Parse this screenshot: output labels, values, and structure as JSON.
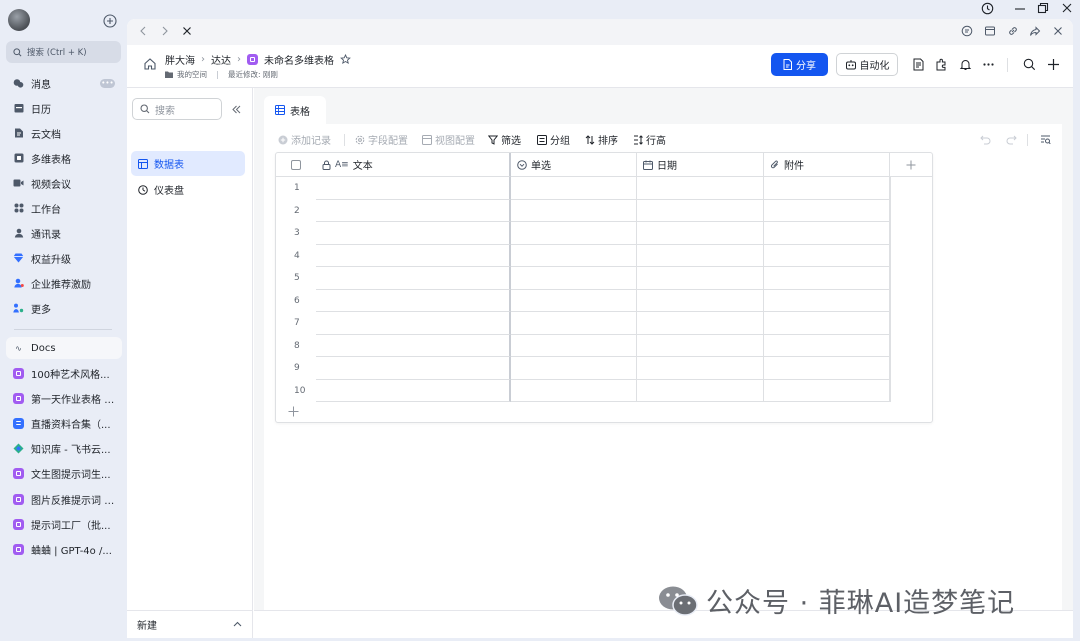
{
  "rail": {
    "search_placeholder": "搜索 (Ctrl + K)",
    "nav": [
      {
        "label": "消息",
        "icon": "chat-icon",
        "badge": "•••"
      },
      {
        "label": "日历",
        "icon": "calendar-icon"
      },
      {
        "label": "云文档",
        "icon": "doc-icon"
      },
      {
        "label": "多维表格",
        "icon": "base-icon"
      },
      {
        "label": "视频会议",
        "icon": "video-icon"
      },
      {
        "label": "工作台",
        "icon": "apps-icon"
      },
      {
        "label": "通讯录",
        "icon": "contacts-icon"
      },
      {
        "label": "权益升级",
        "icon": "diamond-icon"
      },
      {
        "label": "企业推荐激励",
        "icon": "referral-icon"
      },
      {
        "label": "更多",
        "icon": "more-apps-icon"
      }
    ],
    "docs_label": "Docs",
    "docs": [
      {
        "label": "100种艺术风格...",
        "color": "#a15cf1"
      },
      {
        "label": "第一天作业表格 -...",
        "color": "#a15cf1"
      },
      {
        "label": "直播资料合集（...",
        "color": "#3370ff"
      },
      {
        "label": "知识库 - 飞书云...",
        "color": "#2bb08a"
      },
      {
        "label": "文生图提示词生...",
        "color": "#a15cf1"
      },
      {
        "label": "图片反推提示词 -...",
        "color": "#a15cf1"
      },
      {
        "label": "提示词工厂（批...",
        "color": "#a15cf1"
      },
      {
        "label": "蛐蛐 | GPT-4o /...",
        "color": "#a15cf1"
      }
    ]
  },
  "header": {
    "crumbs": [
      "胖大海",
      "达达"
    ],
    "doc_title": "未命名多维表格",
    "space_label": "我的空间",
    "last_modified": "最近修改: 刚刚",
    "share_label": "分享",
    "automation_label": "自动化"
  },
  "sidebar": {
    "search_placeholder": "搜索",
    "items": [
      {
        "label": "数据表"
      },
      {
        "label": "仪表盘"
      }
    ],
    "new_label": "新建"
  },
  "content": {
    "tab_label": "表格",
    "toolbar": {
      "add_record": "添加记录",
      "field_config": "字段配置",
      "view_config": "视图配置",
      "filter": "筛选",
      "group": "分组",
      "sort": "排序",
      "row_height": "行高"
    },
    "columns": [
      {
        "label": "文本",
        "icon": "text-field-icon"
      },
      {
        "label": "单选",
        "icon": "single-select-icon"
      },
      {
        "label": "日期",
        "icon": "date-icon"
      },
      {
        "label": "附件",
        "icon": "attachment-icon"
      }
    ],
    "rows": [
      "1",
      "2",
      "3",
      "4",
      "5",
      "6",
      "7",
      "8",
      "9",
      "10"
    ]
  },
  "watermark": "公众号 · 菲琳AI造梦笔记",
  "colors": {
    "accent": "#1456f0",
    "active_bg": "#e1eaff"
  }
}
